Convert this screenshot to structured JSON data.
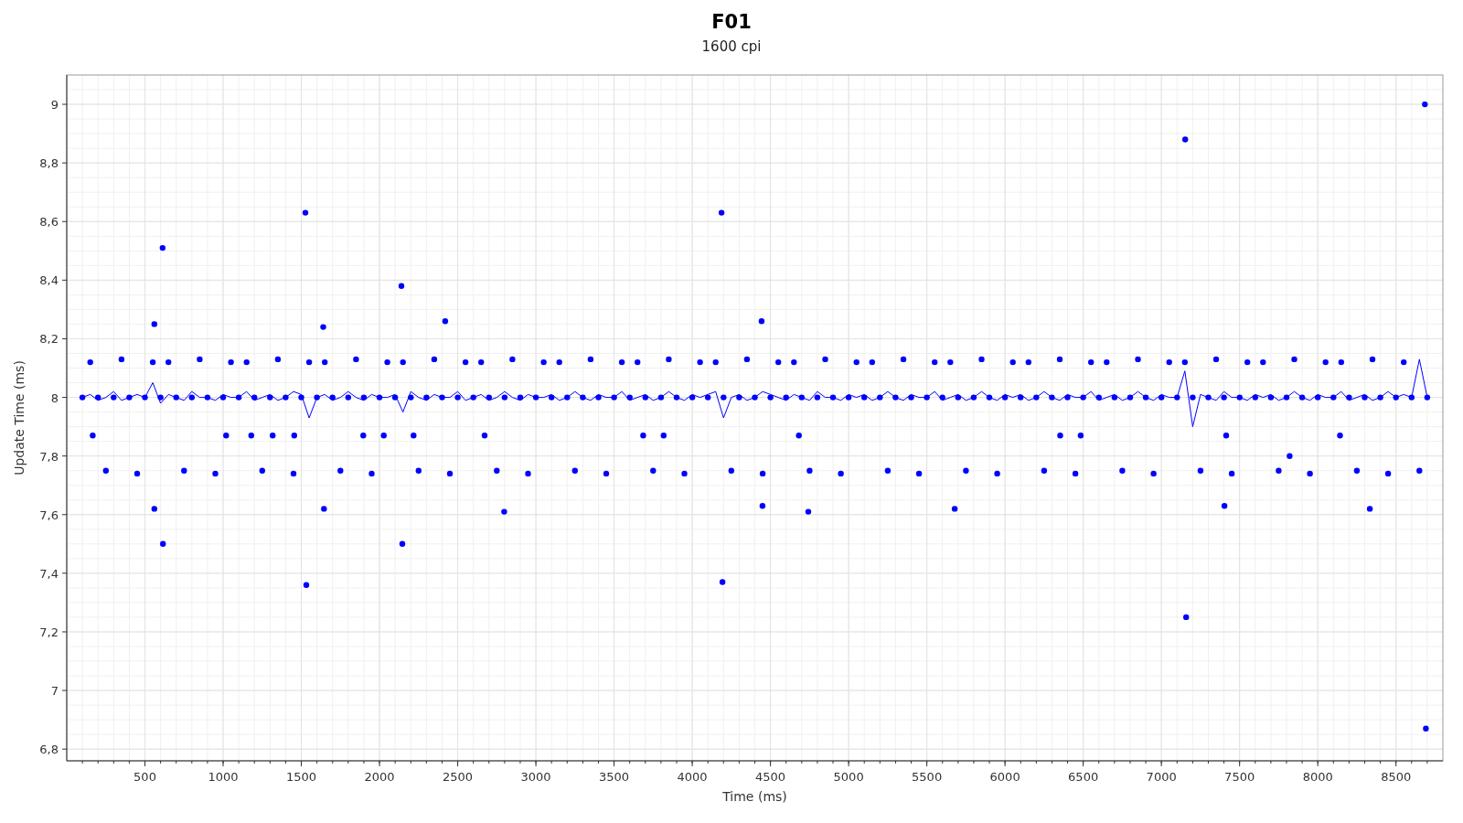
{
  "chart": {
    "subtitle": "1600 cpi",
    "chart_data": {
      "type": "scatter",
      "grid": true,
      "title": "F01",
      "xlabel": "Time (ms)",
      "ylabel": "Update Time (ms)",
      "xlim": [
        0,
        8800
      ],
      "ylim": [
        6.76,
        9.1
      ],
      "xticks": [
        500,
        1000,
        1500,
        2000,
        2500,
        3000,
        3500,
        4000,
        4500,
        5000,
        5500,
        6000,
        6500,
        7000,
        7500,
        8000,
        8500
      ],
      "yticks": [
        {
          "value": 6.8,
          "label": "6,8"
        },
        {
          "value": 7,
          "label": "7"
        },
        {
          "value": 7.2,
          "label": "7,2"
        },
        {
          "value": 7.4,
          "label": "7,4"
        },
        {
          "value": 7.6,
          "label": "7,6"
        },
        {
          "value": 7.8,
          "label": "7,8"
        },
        {
          "value": 8,
          "label": "8"
        },
        {
          "value": 8.2,
          "label": "8,2"
        },
        {
          "value": 8.4,
          "label": "8,4"
        },
        {
          "value": 8.6,
          "label": "8,6"
        },
        {
          "value": 8.8,
          "label": "8,8"
        },
        {
          "value": 9,
          "label": "9"
        }
      ],
      "x": [
        100,
        150,
        200,
        250,
        300,
        350,
        400,
        450,
        500,
        550,
        600,
        650,
        700,
        750,
        800,
        850,
        900,
        950,
        1000,
        1050,
        1100,
        1150,
        1200,
        1250,
        1300,
        1350,
        1400,
        1450,
        1500,
        1550,
        1600,
        1650,
        1700,
        1750,
        1800,
        1850,
        1900,
        1950,
        2000,
        2050,
        2100,
        2150,
        2200,
        2250,
        2300,
        2350,
        2400,
        2450,
        2500,
        2550,
        2600,
        2650,
        2700,
        2750,
        2800,
        2850,
        2900,
        2950,
        3000,
        3050,
        3100,
        3150,
        3200,
        3250,
        3300,
        3350,
        3400,
        3450,
        3500,
        3550,
        3600,
        3650,
        3700,
        3750,
        3800,
        3850,
        3900,
        3950,
        4000,
        4050,
        4100,
        4150,
        4200,
        4250,
        4300,
        4350,
        4400,
        4450,
        4500,
        4550,
        4600,
        4650,
        4700,
        4750,
        4800,
        4850,
        4900,
        4950,
        5000,
        5050,
        5100,
        5150,
        5200,
        5250,
        5300,
        5350,
        5400,
        5450,
        5500,
        5550,
        5600,
        5650,
        5700,
        5750,
        5800,
        5850,
        5900,
        5950,
        6000,
        6050,
        6100,
        6150,
        6200,
        6250,
        6300,
        6350,
        6400,
        6450,
        6500,
        6550,
        6600,
        6650,
        6700,
        6750,
        6800,
        6850,
        6900,
        6950,
        7000,
        7050,
        7100,
        7150,
        7200,
        7250,
        7300,
        7350,
        7400,
        7450,
        7500,
        7550,
        7600,
        7650,
        7700,
        7750,
        7800,
        7850,
        7900,
        7950,
        8000,
        8050,
        8100,
        8150,
        8200,
        8250,
        8300,
        8350,
        8400,
        8450,
        8500,
        8550,
        8600,
        8650,
        8700,
        560,
        613,
        560,
        615,
        1526,
        1532,
        1640,
        1645,
        2140,
        2146,
        2420,
        2797,
        4187,
        4193,
        4443,
        4449,
        4742,
        5678,
        7152,
        7158,
        7403,
        8333,
        8685,
        8691,
        7820,
        166,
        1019,
        1180,
        1317,
        1455,
        1896,
        2027,
        2218,
        2672,
        3686,
        3817,
        4682,
        6353,
        6484,
        8142,
        7414
      ],
      "series": [
        {
          "color": "#0000ff",
          "values": [
            8,
            8.12,
            8,
            7.75,
            8,
            8.13,
            8,
            7.74,
            8,
            8.12,
            8,
            8.12,
            8,
            7.75,
            8,
            8.13,
            8,
            7.74,
            8,
            8.12,
            8,
            8.12,
            8,
            7.75,
            8,
            8.13,
            8,
            7.74,
            8,
            8.12,
            8,
            8.12,
            8,
            7.75,
            8,
            8.13,
            8,
            7.74,
            8,
            8.12,
            8,
            8.12,
            8,
            7.75,
            8,
            8.13,
            8,
            7.74,
            8,
            8.12,
            8,
            8.12,
            8,
            7.75,
            8,
            8.13,
            8,
            7.74,
            8,
            8.12,
            8,
            8.12,
            8,
            7.75,
            8,
            8.13,
            8,
            7.74,
            8,
            8.12,
            8,
            8.12,
            8,
            7.75,
            8,
            8.13,
            8,
            7.74,
            8,
            8.12,
            8,
            8.12,
            8,
            7.75,
            8,
            8.13,
            8,
            7.74,
            8,
            8.12,
            8,
            8.12,
            8,
            7.75,
            8,
            8.13,
            8,
            7.74,
            8,
            8.12,
            8,
            8.12,
            8,
            7.75,
            8,
            8.13,
            8,
            7.74,
            8,
            8.12,
            8,
            8.12,
            8,
            7.75,
            8,
            8.13,
            8,
            7.74,
            8,
            8.12,
            8,
            8.12,
            8,
            7.75,
            8,
            8.13,
            8,
            7.74,
            8,
            8.12,
            8,
            8.12,
            8,
            7.75,
            8,
            8.13,
            8,
            7.74,
            8,
            8.12,
            8,
            8.12,
            8,
            7.75,
            8,
            8.13,
            8,
            7.74,
            8,
            8.12,
            8,
            8.12,
            8,
            7.75,
            8,
            8.13,
            8,
            7.74,
            8,
            8.12,
            8,
            8.12,
            8,
            7.75,
            8,
            8.13,
            8,
            7.74,
            8,
            8.12,
            8,
            7.75,
            8,
            8.25,
            8.51,
            7.62,
            7.5,
            8.63,
            7.36,
            8.24,
            7.62,
            8.38,
            7.5,
            8.26,
            7.61,
            8.63,
            7.37,
            8.26,
            7.63,
            7.61,
            7.62,
            8.88,
            7.25,
            7.63,
            7.62,
            9,
            6.87,
            7.8,
            7.87,
            7.87,
            7.87,
            7.87,
            7.87,
            7.87,
            7.87,
            7.87,
            7.87,
            7.87,
            7.87,
            7.87,
            7.87,
            7.87,
            7.87,
            7.87
          ]
        },
        {
          "color": "#0000ff",
          "type": "line",
          "values": [
            8,
            8.01,
            7.99,
            8,
            8.02,
            7.99,
            8,
            8.01,
            8,
            8.05,
            7.98,
            8.01,
            8,
            7.99,
            8.02,
            8,
            8,
            7.99,
            8.01,
            8,
            8,
            8.02,
            7.99,
            8,
            8.01,
            7.99,
            8,
            8.02,
            8.01,
            7.93,
            8,
            8.01,
            7.99,
            8,
            8.02,
            8,
            7.99,
            8.01,
            8,
            8,
            8.01,
            7.95,
            8.02,
            8,
            7.99,
            8.01,
            8,
            8,
            8.02,
            7.99,
            8,
            8.01,
            7.99,
            8,
            8.02,
            8,
            7.99,
            8.01,
            8,
            8,
            8.01,
            7.99,
            8,
            8.02,
            8,
            7.99,
            8.01,
            8,
            8,
            8.02,
            7.99,
            8,
            8.01,
            7.99,
            8,
            8.02,
            8,
            7.99,
            8.01,
            8,
            8.01,
            8.02,
            7.93,
            8,
            8.01,
            7.99,
            8,
            8.02,
            8.01,
            8,
            7.99,
            8.01,
            8,
            7.99,
            8.02,
            8,
            8,
            7.99,
            8.01,
            8,
            8.01,
            7.99,
            8,
            8.02,
            8,
            7.99,
            8.01,
            8,
            8,
            8.02,
            7.99,
            8,
            8.01,
            7.99,
            8,
            8.02,
            8,
            7.99,
            8.01,
            8,
            8.01,
            7.99,
            8,
            8.02,
            8,
            7.99,
            8.01,
            8,
            8,
            8.02,
            7.99,
            8,
            8.01,
            7.99,
            8,
            8.02,
            8,
            7.99,
            8.01,
            8,
            8,
            8.09,
            7.9,
            8.01,
            8,
            7.99,
            8.02,
            8,
            8,
            7.99,
            8.01,
            8,
            8.01,
            7.99,
            8,
            8.02,
            8,
            7.99,
            8.01,
            8,
            8,
            8.02,
            7.99,
            8,
            8.01,
            7.99,
            8,
            8.02,
            8,
            8.01,
            8,
            8.13,
            8,
            null,
            null,
            null,
            null,
            null,
            null,
            null,
            null,
            null,
            null,
            null,
            null,
            null,
            null,
            null,
            null,
            null,
            null,
            null,
            null,
            null,
            null,
            null,
            null,
            null,
            null,
            null,
            null,
            null,
            null,
            null,
            null,
            null,
            null,
            null,
            null,
            null,
            null,
            null,
            null,
            null
          ]
        }
      ]
    }
  }
}
